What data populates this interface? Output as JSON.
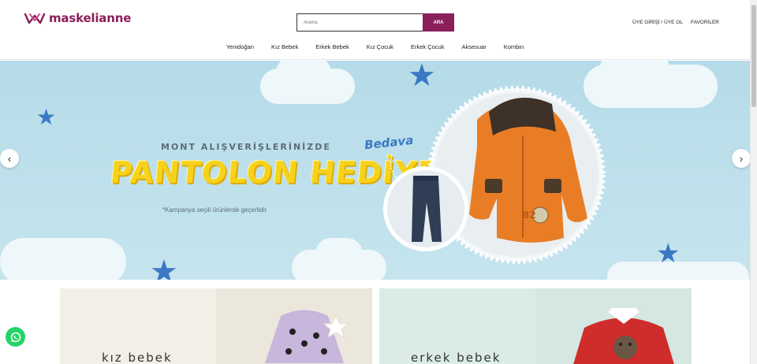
{
  "header": {
    "logo_text": "maskelianne",
    "search": {
      "placeholder": "Arama",
      "button_label": "ARA"
    },
    "user_links": {
      "login": "ÜYE GİRİŞİ / ÜYE OL",
      "favorites": "FAVORİLER"
    }
  },
  "nav": {
    "items": [
      {
        "label": "Yenidoğan"
      },
      {
        "label": "Kız Bebek"
      },
      {
        "label": "Erkek Bebek"
      },
      {
        "label": "Kız Çocuk"
      },
      {
        "label": "Erkek Çocuk"
      },
      {
        "label": "Aksesuar"
      },
      {
        "label": "Kombin"
      }
    ]
  },
  "banner": {
    "subtitle": "MONT ALIŞVERİŞLERİNİZDE",
    "title": "PANTOLON HEDİYE",
    "note": "*Kampanya seçili ürünlerde geçerlidir.",
    "badge": "Bedava",
    "prev_icon": "chevron-left-icon",
    "next_icon": "chevron-right-icon"
  },
  "categories": [
    {
      "label": "kız bebek"
    },
    {
      "label": "erkek bebek"
    }
  ],
  "colors": {
    "brand": "#8a1f5a",
    "banner_bg": "#b5dbe8",
    "title_yellow": "#f7d21a",
    "whatsapp": "#25d366"
  }
}
